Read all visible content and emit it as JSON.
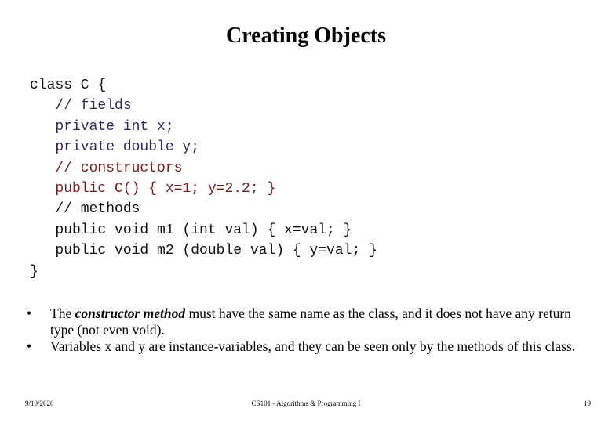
{
  "slide": {
    "title": "Creating Objects",
    "code_lines": [
      {
        "text": "class C {",
        "color": "#111111"
      },
      {
        "text": "   // fields",
        "color": "#2b2b5e"
      },
      {
        "text": "   private int x;",
        "color": "#2b2b5e"
      },
      {
        "text": "   private double y;",
        "color": "#2b2b5e"
      },
      {
        "text": "   // constructors",
        "color": "#7a1c1c"
      },
      {
        "text": "   public C() { x=1; y=2.2; }",
        "color": "#7a1c1c"
      },
      {
        "text": "   // methods",
        "color": "#111111"
      },
      {
        "text": "   public void m1 (int val) { x=val; }",
        "color": "#111111"
      },
      {
        "text": "   public void m2 (double val) { y=val; }",
        "color": "#111111"
      },
      {
        "text": "}",
        "color": "#111111"
      }
    ],
    "bullets": [
      {
        "pre": "The ",
        "emphasis": "constructor method",
        "post": " must have the same name as the class, and it does not have any return type (not even void)."
      },
      {
        "pre": "Variables x and y are instance-variables, and they can be seen only by the methods of this class.",
        "emphasis": "",
        "post": ""
      }
    ],
    "bullet_glyph": "•"
  },
  "footer": {
    "date": "9/10/2020",
    "course": "CS101 - Algorithms & Programming I",
    "page": "19"
  }
}
